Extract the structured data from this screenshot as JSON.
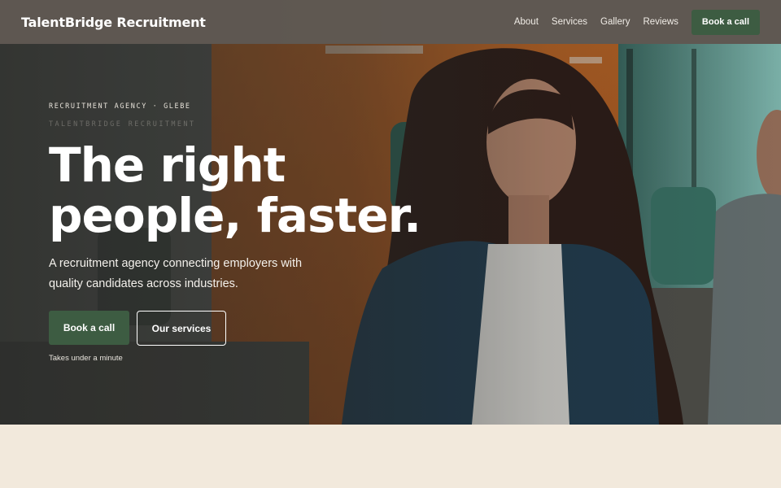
{
  "header": {
    "brand": "TalentBridge Recruitment",
    "nav": [
      "About",
      "Services",
      "Gallery",
      "Reviews"
    ],
    "cta_label": "Book a call"
  },
  "hero": {
    "eyebrow": "RECRUITMENT AGENCY · GLEBE",
    "eyebrow_sub": "TALENTBRIDGE RECRUITMENT",
    "headline_line1": "The right",
    "headline_line2": "people, faster.",
    "subtext": "A recruitment agency connecting employers with quality candidates across industries.",
    "primary_button": "Book a call",
    "secondary_button": "Our services",
    "note": "Takes under a minute"
  },
  "colors": {
    "accent": "#3d5c42",
    "header_bg": "#605953",
    "page_bg": "#f2e9dc"
  }
}
